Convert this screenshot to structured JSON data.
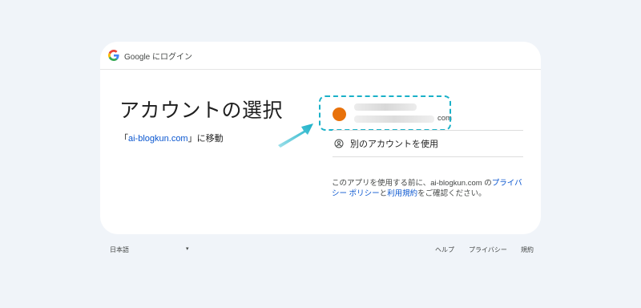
{
  "header": {
    "title": "Google にログイン"
  },
  "main": {
    "title": "アカウントの選択",
    "continue_pre": "「",
    "continue_link": "ai-blogkun.com",
    "continue_post": "」に移動"
  },
  "account": {
    "email_suffix": "com",
    "avatar_color": "#e8710a"
  },
  "other_account": {
    "label": "別のアカウントを使用"
  },
  "privacy": {
    "text1": "このアプリを使用する前に、ai-blogkun.com の",
    "privacy_link": "プライバシー ポリシー",
    "and": "と",
    "terms_link": "利用規約",
    "text2": "をご確認ください。"
  },
  "footer": {
    "language": "日本語",
    "caret": "▾",
    "help": "ヘルプ",
    "privacy": "プライバシー",
    "terms": "規約"
  },
  "colors": {
    "accent_link": "#0b57d0",
    "highlight": "#1bb1c8",
    "background": "#f0f4f9"
  }
}
